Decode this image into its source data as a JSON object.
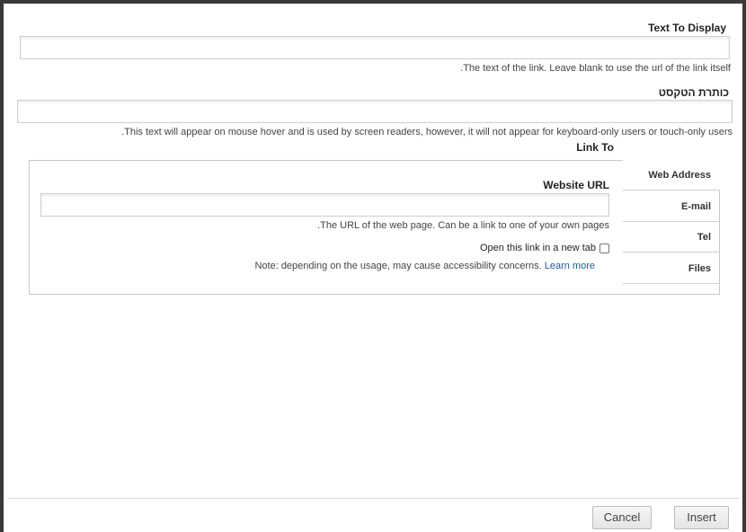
{
  "text_to_display": {
    "label": "Text To Display",
    "value": "",
    "hint": ".The text of the link. Leave blank to use the url of the link itself"
  },
  "title_text": {
    "label": "כותרת הטקסט",
    "value": "",
    "hint": ".This text will appear on mouse hover and is used by screen readers, however, it will not appear for keyboard-only users or touch-only users"
  },
  "link_to": {
    "label": "Link To",
    "tabs": [
      {
        "label": "Web Address",
        "active": true
      },
      {
        "label": "E-mail",
        "active": false
      },
      {
        "label": "Tel",
        "active": false
      },
      {
        "label": "Files",
        "active": false
      }
    ],
    "website_url": {
      "label": "Website URL",
      "value": "",
      "hint": ".The URL of the web page. Can be a link to one of your own pages"
    },
    "new_tab": {
      "label": "Open this link in a new tab",
      "checked": false
    },
    "note": "Note: depending on the usage, may cause accessibility concerns.",
    "learn_more": "Learn more"
  },
  "footer": {
    "cancel_label": "Cancel",
    "insert_label": "Insert"
  }
}
